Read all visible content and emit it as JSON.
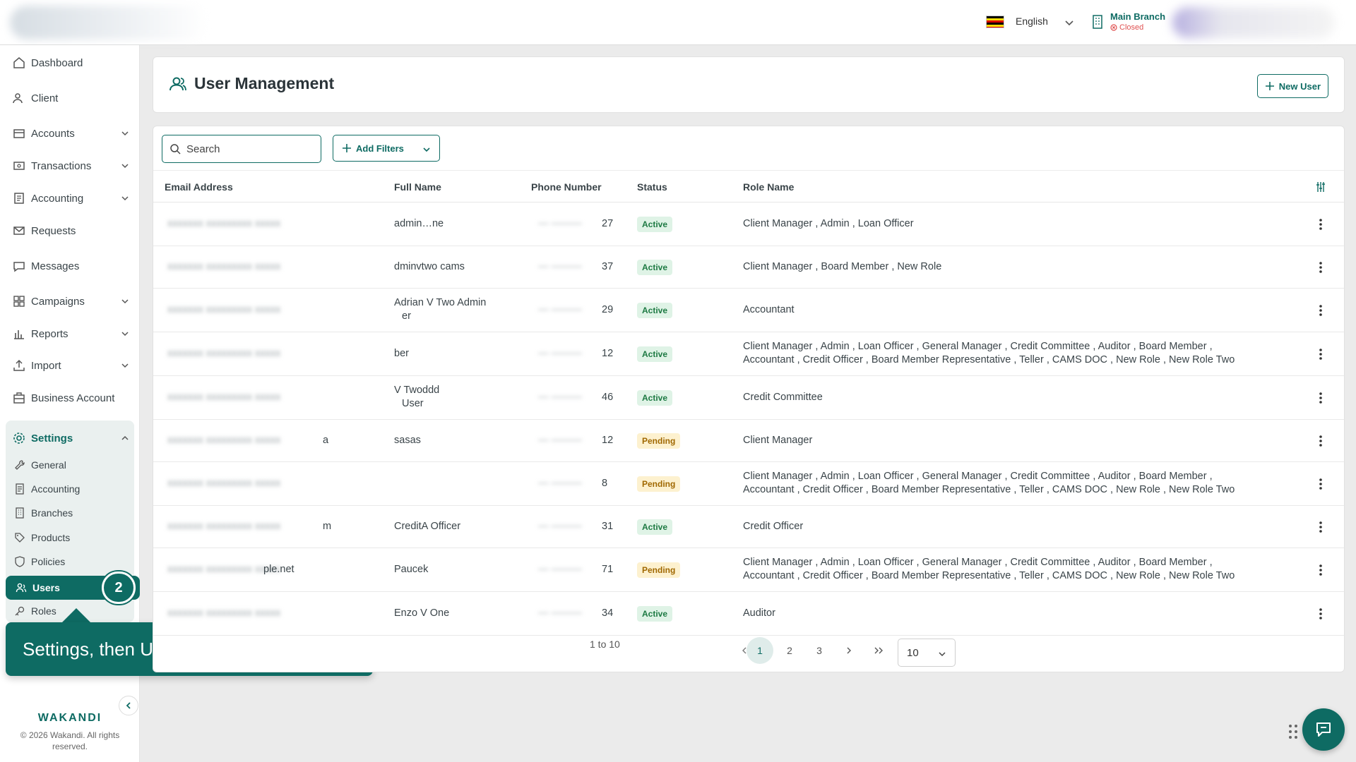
{
  "topbar": {
    "language": "English",
    "branch_name": "Main Branch",
    "branch_status": "Closed"
  },
  "sidebar": {
    "items": [
      {
        "label": "Dashboard",
        "icon": "home-icon"
      },
      {
        "label": "Client",
        "icon": "client-icon"
      },
      {
        "label": "Accounts",
        "icon": "accounts-icon",
        "expandable": true
      },
      {
        "label": "Transactions",
        "icon": "transactions-icon",
        "expandable": true
      },
      {
        "label": "Accounting",
        "icon": "accounting-icon",
        "expandable": true
      },
      {
        "label": "Requests",
        "icon": "requests-icon"
      },
      {
        "label": "Messages",
        "icon": "messages-icon"
      },
      {
        "label": "Campaigns",
        "icon": "campaigns-icon",
        "expandable": true
      },
      {
        "label": "Reports",
        "icon": "reports-icon",
        "expandable": true
      },
      {
        "label": "Import",
        "icon": "import-icon",
        "expandable": true
      },
      {
        "label": "Business Account",
        "icon": "business-icon"
      }
    ],
    "settings": {
      "label": "Settings",
      "sub_items": [
        "General",
        "Accounting",
        "Branches",
        "Products",
        "Policies",
        "Users",
        "Roles"
      ]
    },
    "step_number": "2",
    "tooltip": "Settings, then Users",
    "logo": "WAKANDI",
    "copyright": "© 2026 Wakandi. All rights reserved."
  },
  "header": {
    "title": "User Management",
    "new_user_label": "New User"
  },
  "toolbar": {
    "search_placeholder": "Search",
    "filter_label": "Add Filters"
  },
  "table": {
    "columns": [
      "Email Address",
      "Full Name",
      "Phone Number",
      "Status",
      "Role Name"
    ],
    "rows": [
      {
        "email": "",
        "name": "admin…ne",
        "phone": "27",
        "status": "Active",
        "roles": "Client Manager , Admin , Loan Officer"
      },
      {
        "email": "",
        "name": "dminvtwo cams",
        "phone": "37",
        "status": "Active",
        "roles": "Client Manager , Board Member , New Role"
      },
      {
        "email": "",
        "name": "Adrian V Two Admin",
        "name2": "er",
        "phone": "29",
        "status": "Active",
        "roles": "Accountant"
      },
      {
        "email": "",
        "name": "ber",
        "phone": "12",
        "status": "Active",
        "roles": "Client Manager , Admin , Loan Officer , General Manager , Credit Committee , Auditor , Board Member ,",
        "roles2": "Accountant , Credit Officer , Board Member Representative , Teller , CAMS DOC , New Role , New Role Two"
      },
      {
        "email": "",
        "name": "V Twoddd",
        "name2": "User",
        "phone": "46",
        "status": "Active",
        "roles": "Credit Committee"
      },
      {
        "email": "a",
        "name": "sasas",
        "phone": "12",
        "status": "Pending",
        "roles": "Client Manager"
      },
      {
        "email": "",
        "name": "",
        "phone": "8",
        "status": "Pending",
        "roles": "Client Manager , Admin , Loan Officer , General Manager , Credit Committee , Auditor , Board Member ,",
        "roles2": "Accountant , Credit Officer , Board Member Representative , Teller , CAMS DOC , New Role , New Role Two"
      },
      {
        "email": "m",
        "name": "CreditA Officer",
        "phone": "31",
        "status": "Active",
        "roles": "Credit Officer"
      },
      {
        "email": "ple.net",
        "name": "Paucek",
        "phone": "71",
        "status": "Pending",
        "roles": "Client Manager , Admin , Loan Officer , General Manager , Credit Committee , Auditor , Board Member ,",
        "roles2": "Accountant , Credit Officer , Board Member Representative , Teller , CAMS DOC , New Role , New Role Two"
      },
      {
        "email": "",
        "name": "Enzo V One",
        "phone": "34",
        "status": "Active",
        "roles": "Auditor"
      }
    ]
  },
  "pagination": {
    "range": "1 to 10",
    "pages": [
      "1",
      "2",
      "3"
    ],
    "current": "1",
    "page_size": "10"
  },
  "colors": {
    "primary": "#0e6b63",
    "active_bg": "#dff3e6",
    "pending_bg": "#fdf1cf"
  }
}
